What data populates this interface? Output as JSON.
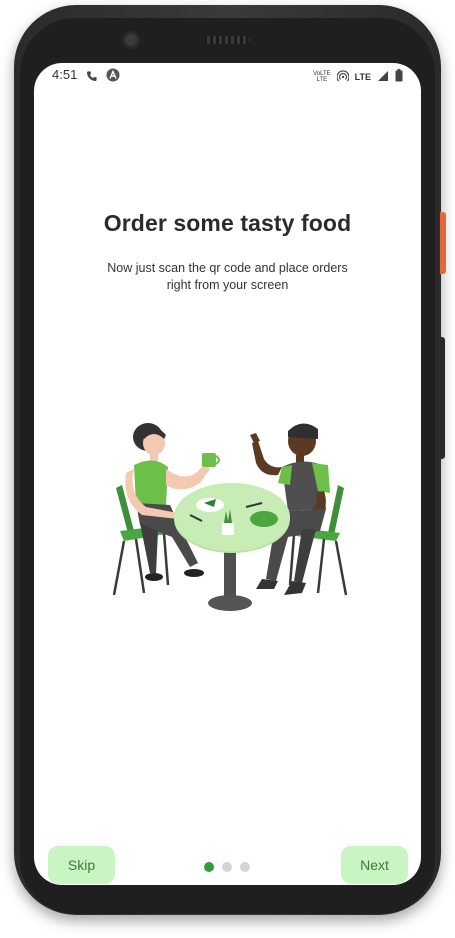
{
  "status_bar": {
    "time": "4:51",
    "lte_small_top": "VoLTE",
    "lte_small_bottom": "LTE",
    "lte_label": "LTE",
    "icons": [
      "phone-icon",
      "a-circle-icon",
      "hotspot-icon",
      "signal-icon",
      "battery-icon"
    ]
  },
  "onboarding": {
    "title": "Order some tasty food",
    "subtitle": "Now just scan the qr code and place orders right from your screen",
    "illustration": "two-people-dining-illustration",
    "page_indicator": {
      "current": 1,
      "total": 3
    }
  },
  "buttons": {
    "skip_label": "Skip",
    "next_label": "Next"
  },
  "colors": {
    "accent_green": "#2f9e3a",
    "button_bg": "#c9f5c3",
    "button_text": "#3f7a3a",
    "illustration_green": "#6cc04a"
  }
}
